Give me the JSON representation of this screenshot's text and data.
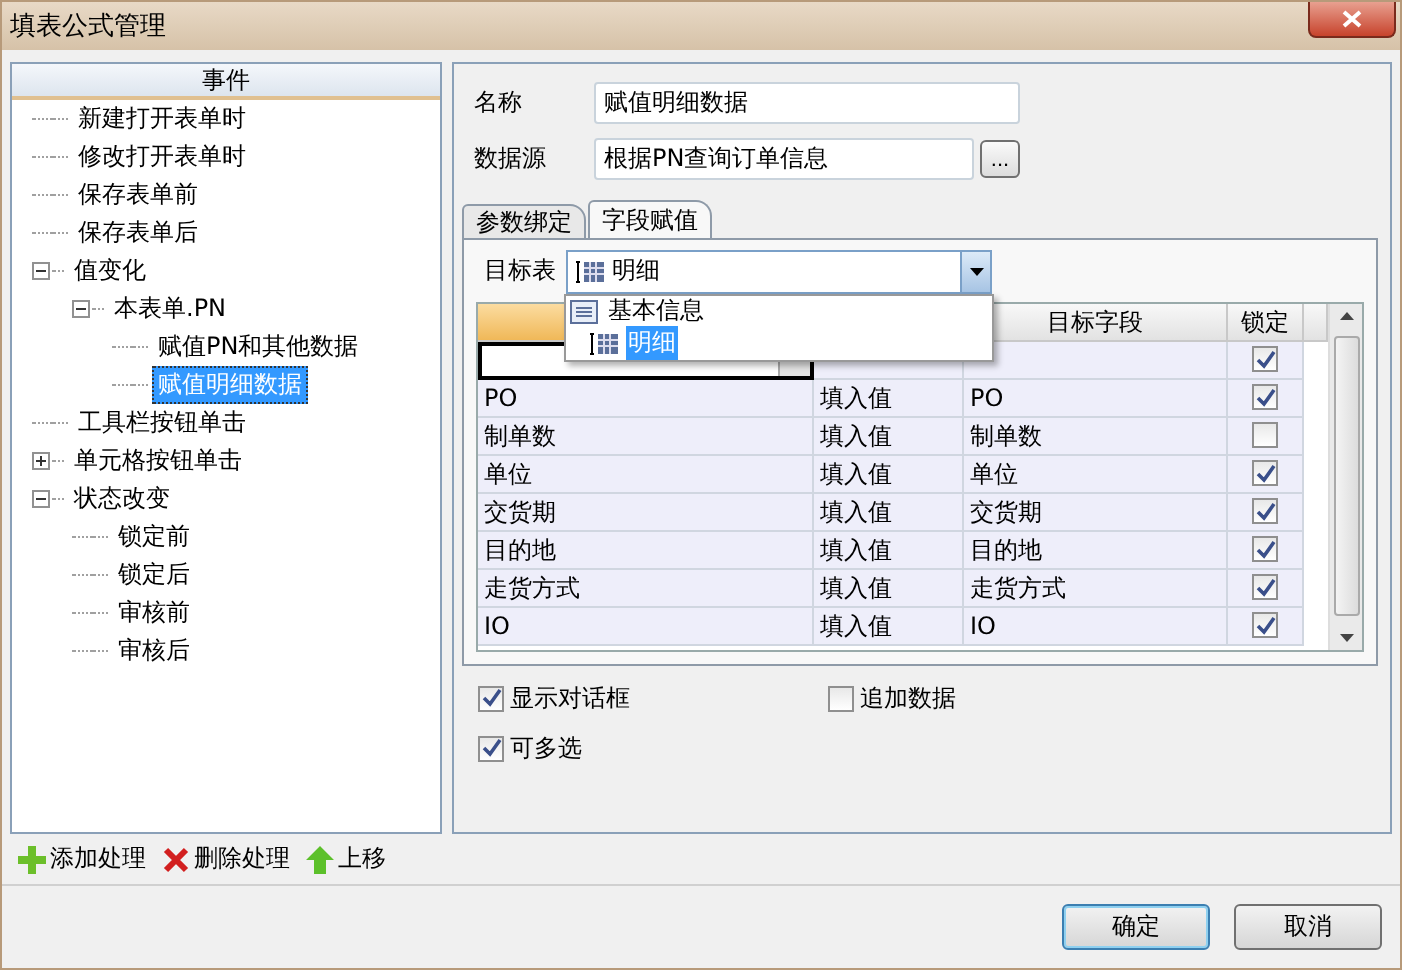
{
  "window": {
    "title": "填表公式管理"
  },
  "tree": {
    "header": "事件",
    "items": [
      {
        "label": "新建打开表单时",
        "selected": false
      },
      {
        "label": "修改打开表单时",
        "selected": false
      },
      {
        "label": "保存表单前",
        "selected": false
      },
      {
        "label": "保存表单后",
        "selected": false
      },
      {
        "label": "值变化",
        "expanded": true,
        "selected": false,
        "children": [
          {
            "label": "本表单.PN",
            "expanded": true,
            "selected": false,
            "children": [
              {
                "label": "赋值PN和其他数据",
                "selected": false
              },
              {
                "label": "赋值明细数据",
                "selected": true
              }
            ]
          }
        ]
      },
      {
        "label": "工具栏按钮单击",
        "selected": false
      },
      {
        "label": "单元格按钮单击",
        "expanded": false,
        "selected": false
      },
      {
        "label": "状态改变",
        "expanded": true,
        "selected": false,
        "children": [
          {
            "label": "锁定前",
            "selected": false
          },
          {
            "label": "锁定后",
            "selected": false
          },
          {
            "label": "审核前",
            "selected": false
          },
          {
            "label": "审核后",
            "selected": false
          }
        ]
      }
    ]
  },
  "toolbar": [
    {
      "kind": "add",
      "label": "添加处理"
    },
    {
      "kind": "delete",
      "label": "删除处理"
    },
    {
      "kind": "up",
      "label": "上移"
    }
  ],
  "form": {
    "name_label": "名称",
    "name_value": "赋值明细数据",
    "source_label": "数据源",
    "source_value": "根据PN查询订单信息",
    "browse_button": "..."
  },
  "tabs": [
    {
      "label": "参数绑定",
      "selected": false
    },
    {
      "label": "字段赋值",
      "selected": true
    }
  ],
  "target": {
    "label": "目标表",
    "value": "明细",
    "options": [
      {
        "kind": "form",
        "label": "基本信息",
        "selected": false
      },
      {
        "kind": "table",
        "label": "明细",
        "selected": true
      }
    ]
  },
  "table": {
    "columns": [
      {
        "highlighted": true
      },
      {
        "title": "目标字段"
      },
      {
        "title": "锁定"
      }
    ],
    "rows": [
      {
        "source": "",
        "locked": true,
        "editing": true
      },
      {
        "source": "PO",
        "mode": "填入值",
        "target": "PO",
        "locked": true,
        "editing": false
      },
      {
        "source": "制单数",
        "mode": "填入值",
        "target": "制单数",
        "locked": false,
        "editing": false
      },
      {
        "source": "单位",
        "mode": "填入值",
        "target": "单位",
        "locked": true,
        "editing": false
      },
      {
        "source": "交货期",
        "mode": "填入值",
        "target": "交货期",
        "locked": true,
        "editing": false
      },
      {
        "source": "目的地",
        "mode": "填入值",
        "target": "目的地",
        "locked": true,
        "editing": false
      },
      {
        "source": "走货方式",
        "mode": "填入值",
        "target": "走货方式",
        "locked": true,
        "editing": false
      },
      {
        "source": "IO",
        "mode": "填入值",
        "target": "IO",
        "locked": true,
        "editing": false
      }
    ]
  },
  "options": [
    {
      "label": "显示对话框",
      "checked": true
    },
    {
      "label": "追加数据",
      "checked": false
    },
    {
      "label": "可多选",
      "checked": true
    }
  ],
  "buttons": [
    {
      "label": "确定",
      "default": true
    },
    {
      "label": "取消",
      "default": false
    }
  ]
}
